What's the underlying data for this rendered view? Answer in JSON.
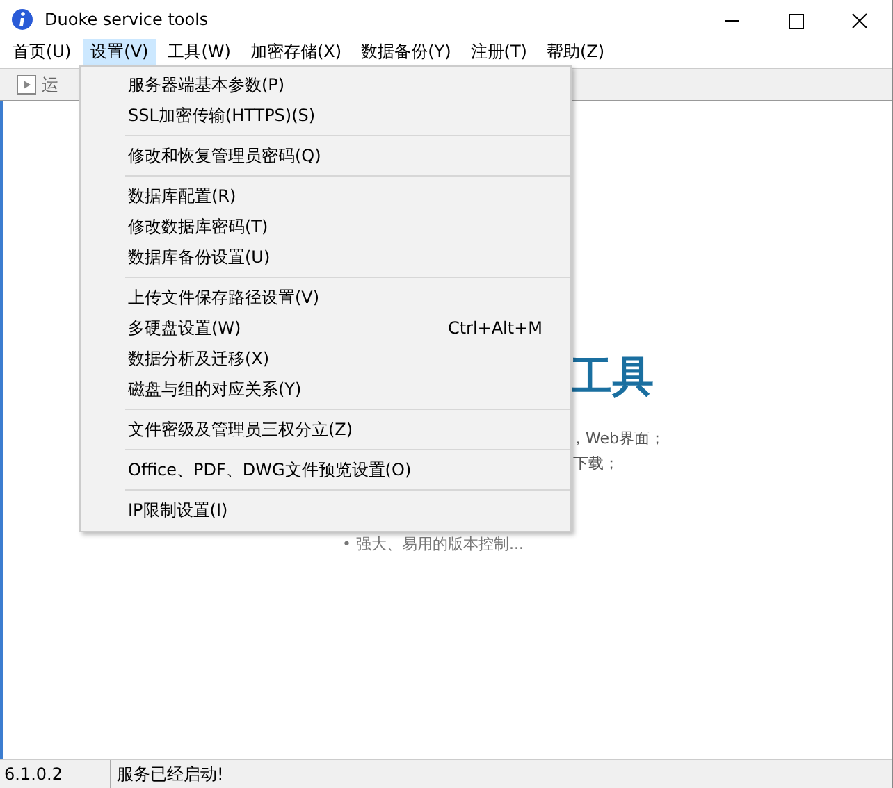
{
  "window": {
    "title": "Duoke service tools"
  },
  "menu_bar": [
    {
      "label": "首页(U)",
      "selected": false
    },
    {
      "label": "设置(V)",
      "selected": true
    },
    {
      "label": "工具(W)",
      "selected": false
    },
    {
      "label": "加密存储(X)",
      "selected": false
    },
    {
      "label": "数据备份(Y)",
      "selected": false
    },
    {
      "label": "注册(T)",
      "selected": false
    },
    {
      "label": "帮助(Z)",
      "selected": false
    }
  ],
  "toolbar": {
    "button": "运"
  },
  "content": {
    "heading": "工具",
    "line_1": "，Web界面；",
    "line_2": "下载；",
    "line_3": "• 强大、易用的版本控制..."
  },
  "dropdown": [
    [
      {
        "label": "服务器端基本参数(P)"
      },
      {
        "label": "SSL加密传输(HTTPS)(S)"
      }
    ],
    [
      {
        "label": "修改和恢复管理员密码(Q)"
      }
    ],
    [
      {
        "label": "数据库配置(R)"
      },
      {
        "label": "修改数据库密码(T)"
      },
      {
        "label": "数据库备份设置(U)"
      }
    ],
    [
      {
        "label": "上传文件保存路径设置(V)"
      },
      {
        "label": "多硬盘设置(W)",
        "shortcut": "Ctrl+Alt+M"
      },
      {
        "label": "数据分析及迁移(X)"
      },
      {
        "label": "磁盘与组的对应关系(Y)"
      }
    ],
    [
      {
        "label": "文件密级及管理员三权分立(Z)"
      }
    ],
    [
      {
        "label": "Office、PDF、DWG文件预览设置(O)"
      }
    ],
    [
      {
        "label": "IP限制设置(I)"
      }
    ]
  ],
  "status_bar": [
    "6.1.0.2",
    "服务已经启动!"
  ]
}
